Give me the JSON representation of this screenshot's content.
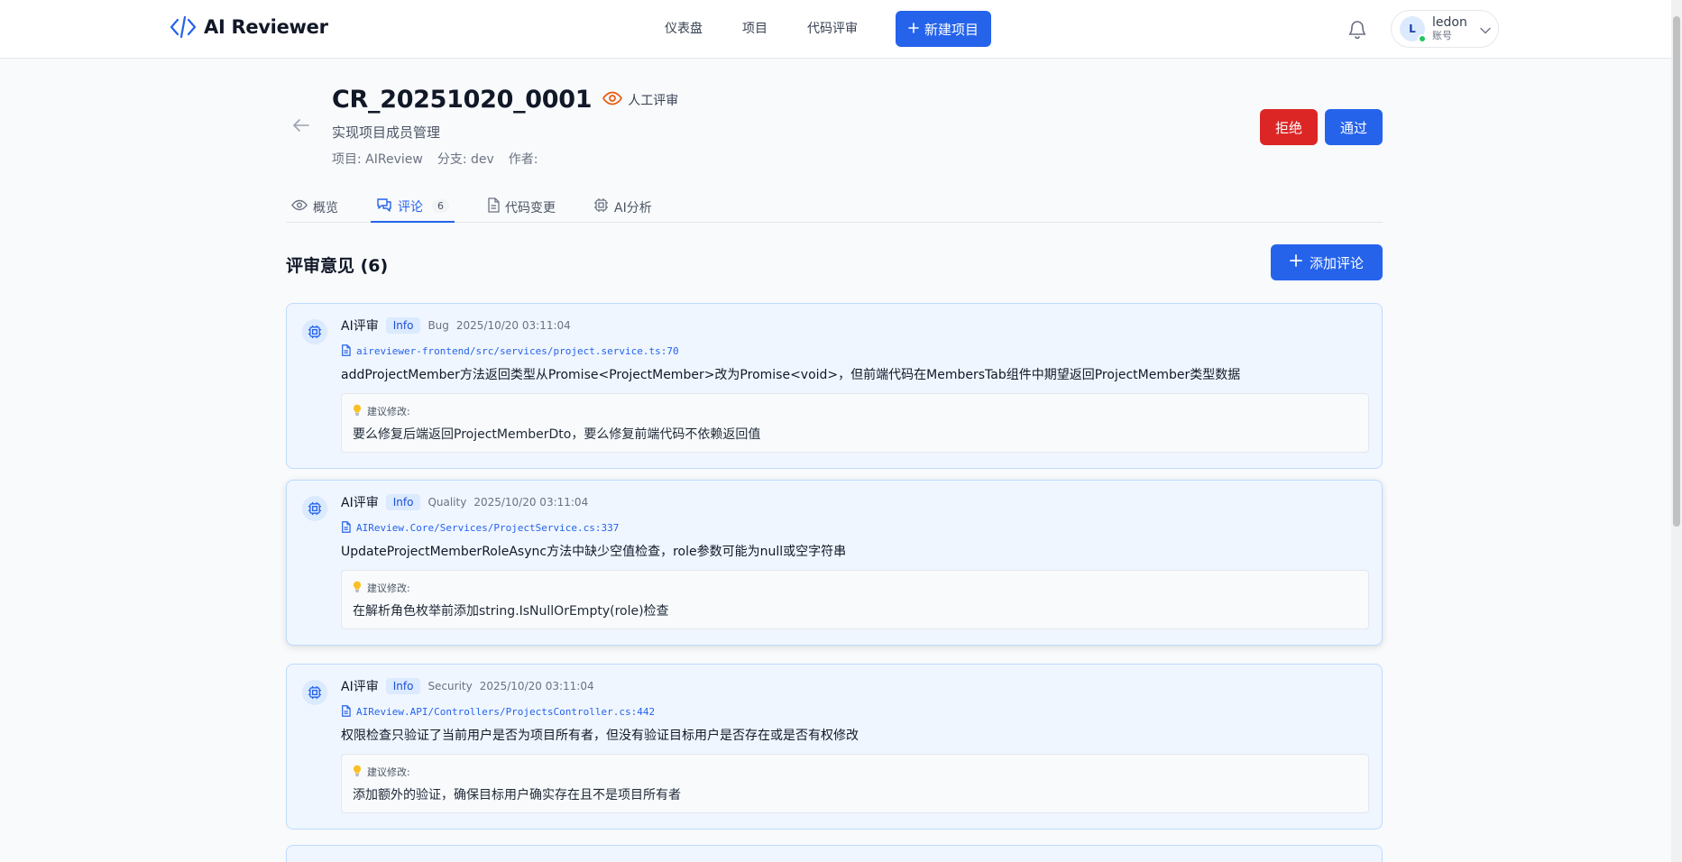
{
  "app": {
    "name": "AI Reviewer"
  },
  "nav": {
    "dashboard": "仪表盘",
    "projects": "项目",
    "code_review": "代码评审",
    "new_project": "新建项目"
  },
  "user": {
    "initial": "L",
    "name": "ledon",
    "role": "账号"
  },
  "review": {
    "id": "CR_20251020_0001",
    "type": "人工评审",
    "subtitle": "实现项目成员管理",
    "project": "项目: AIReview",
    "branch": "分支: dev",
    "author": "作者:",
    "reject_label": "拒绝",
    "approve_label": "通过"
  },
  "tabs": [
    {
      "label": "概览",
      "icon": "eye-icon"
    },
    {
      "label": "评论",
      "icon": "comment-icon",
      "count": "6"
    },
    {
      "label": "代码变更",
      "icon": "file-icon"
    },
    {
      "label": "AI分析",
      "icon": "chip-icon"
    }
  ],
  "comments_section": {
    "title": "评审意见 (6)",
    "add_label": "添加评论"
  },
  "comments": [
    {
      "author": "AI评审",
      "severity": "Info",
      "category": "Bug",
      "time": "2025/10/20 03:11:04",
      "file": "aireviewer-frontend/src/services/project.service.ts:70",
      "message": "addProjectMember方法返回类型从Promise<ProjectMember>改为Promise<void>，但前端代码在MembersTab组件中期望返回ProjectMember类型数据",
      "suggestion_label": "建议修改:",
      "suggestion": "要么修复后端返回ProjectMemberDto，要么修复前端代码不依赖返回值"
    },
    {
      "author": "AI评审",
      "severity": "Info",
      "category": "Quality",
      "time": "2025/10/20 03:11:04",
      "file": "AIReview.Core/Services/ProjectService.cs:337",
      "message": "UpdateProjectMemberRoleAsync方法中缺少空值检查，role参数可能为null或空字符串",
      "suggestion_label": "建议修改:",
      "suggestion": "在解析角色枚举前添加string.IsNullOrEmpty(role)检查"
    },
    {
      "author": "AI评审",
      "severity": "Info",
      "category": "Security",
      "time": "2025/10/20 03:11:04",
      "file": "AIReview.API/Controllers/ProjectsController.cs:442",
      "message": "权限检查只验证了当前用户是否为项目所有者，但没有验证目标用户是否存在或是否有权修改",
      "suggestion_label": "建议修改:",
      "suggestion": "添加额外的验证，确保目标用户确实存在且不是项目所有者"
    }
  ],
  "colors": {
    "primary": "#2563eb",
    "danger": "#dc2626",
    "review_type": "#ea580c",
    "online": "#22c55e"
  }
}
